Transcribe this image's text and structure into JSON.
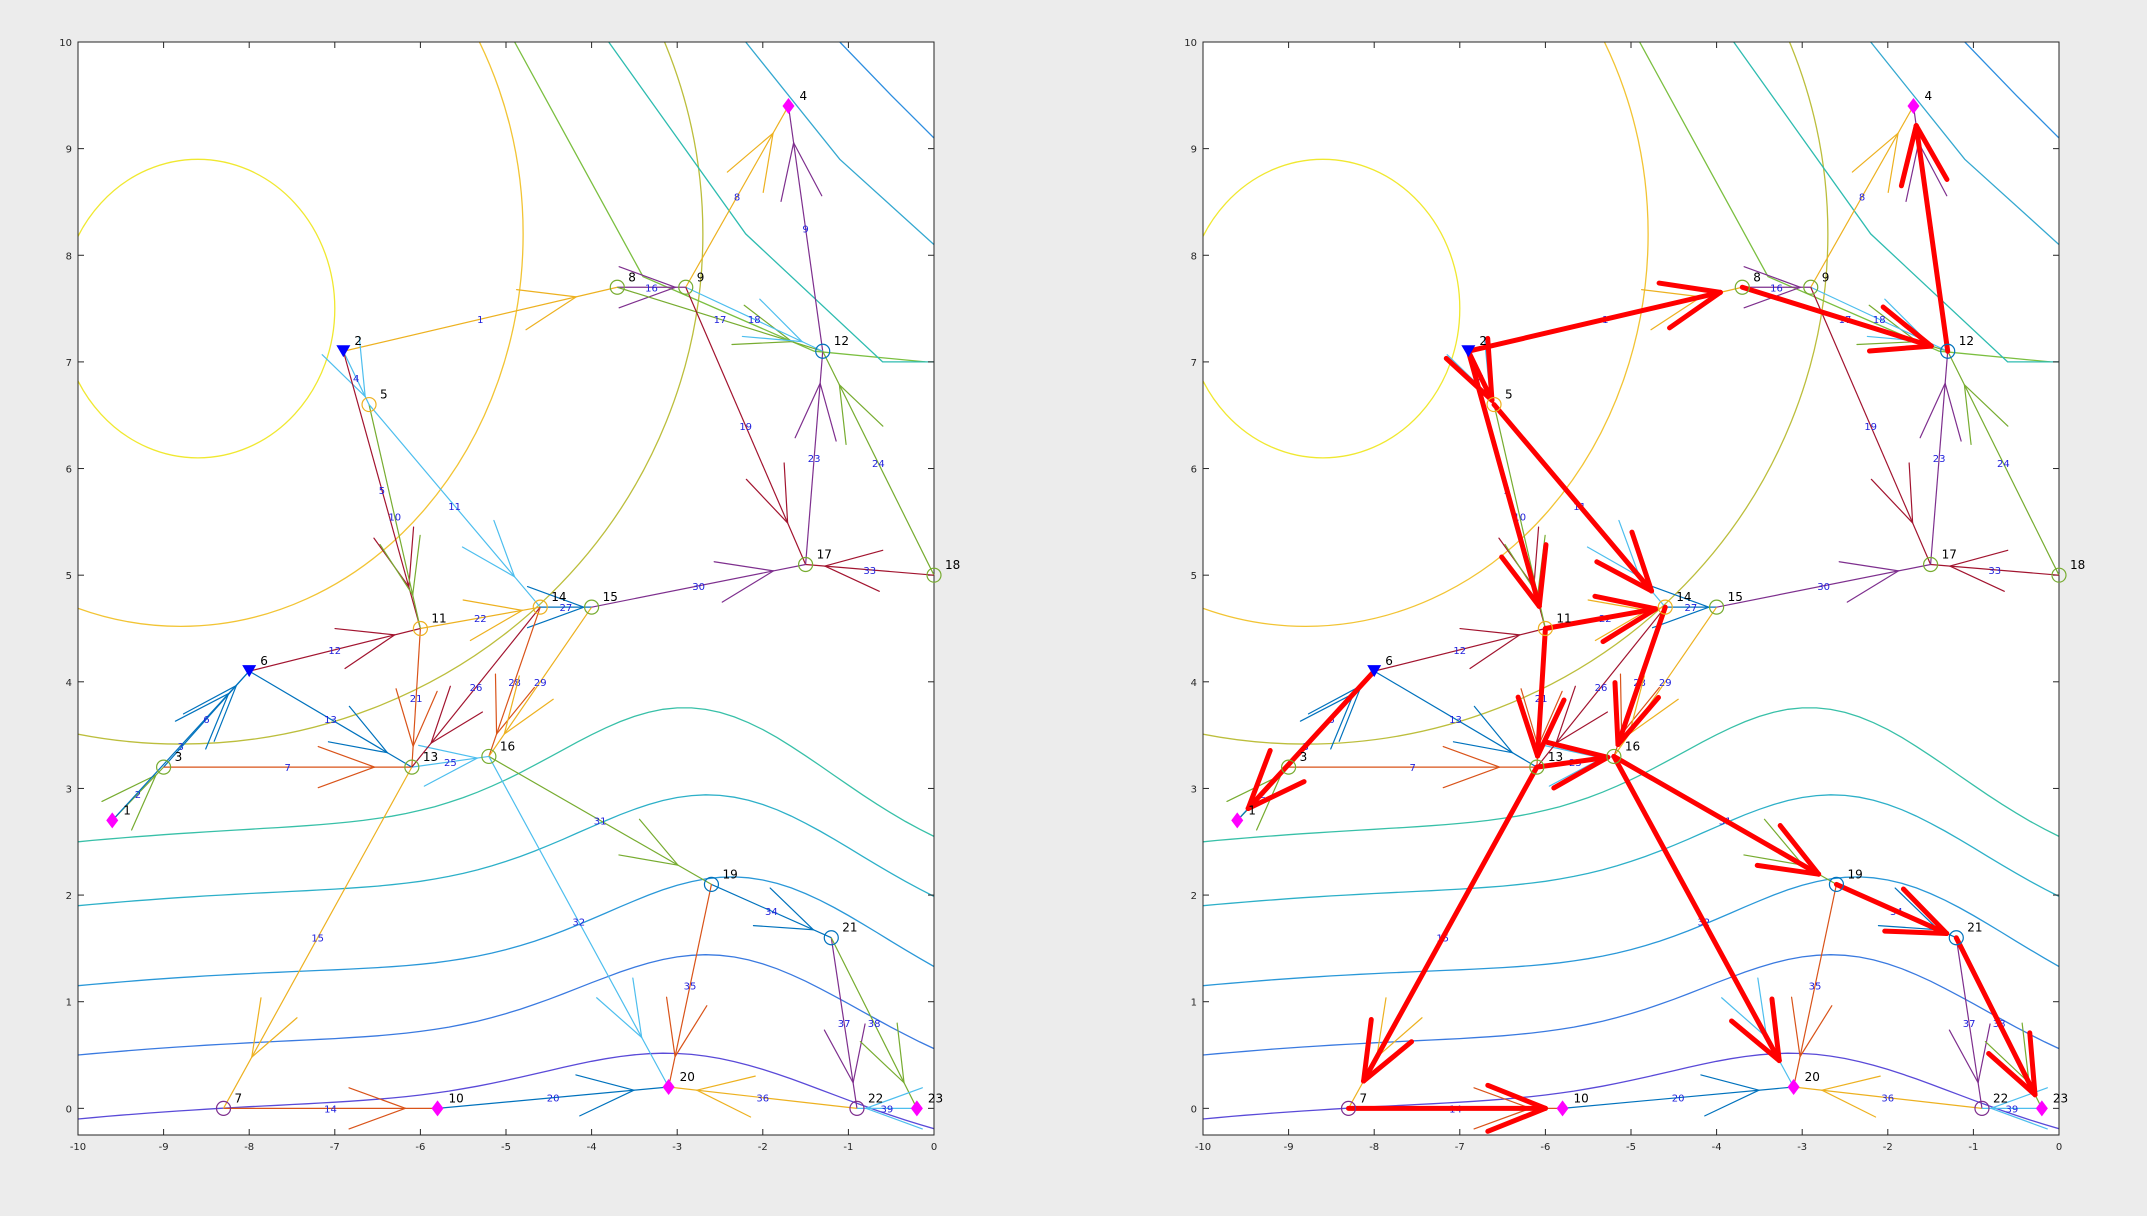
{
  "chart_data": [
    {
      "type": "network",
      "xlim": [
        -10,
        0
      ],
      "ylim": [
        -0.25,
        10
      ],
      "xticks": [
        -10,
        -9,
        -8,
        -7,
        -6,
        -5,
        -4,
        -3,
        -2,
        -1,
        0
      ],
      "yticks": [
        0,
        1,
        2,
        3,
        4,
        5,
        6,
        7,
        8,
        9,
        10
      ],
      "highlight_path": []
    },
    {
      "type": "network",
      "xlim": [
        -10,
        0
      ],
      "ylim": [
        -0.25,
        10
      ],
      "xticks": [
        -10,
        -9,
        -8,
        -7,
        -6,
        -5,
        -4,
        -3,
        -2,
        -1,
        0
      ],
      "yticks": [
        0,
        1,
        2,
        3,
        4,
        5,
        6,
        7,
        8,
        9,
        10
      ],
      "highlight_path": [
        2,
        5,
        11,
        13,
        16,
        19,
        21,
        23,
        8,
        12,
        4,
        6,
        1,
        7,
        10,
        14,
        15,
        20
      ],
      "highlight_color": "#ff0000"
    }
  ],
  "nodes": [
    {
      "id": 1,
      "label": "1",
      "x": -9.6,
      "y": 2.7,
      "marker": "diamond",
      "color": "#ff00ff"
    },
    {
      "id": 2,
      "label": "2",
      "x": -6.9,
      "y": 7.1,
      "marker": "triangle",
      "color": "#0000ff"
    },
    {
      "id": 3,
      "label": "3",
      "x": -9.0,
      "y": 3.2,
      "marker": "circle",
      "color": "#77ac30"
    },
    {
      "id": 4,
      "label": "4",
      "x": -1.7,
      "y": 9.4,
      "marker": "diamond",
      "color": "#ff00ff"
    },
    {
      "id": 5,
      "label": "5",
      "x": -6.6,
      "y": 6.6,
      "marker": "circle",
      "color": "#edb120"
    },
    {
      "id": 6,
      "label": "6",
      "x": -8.0,
      "y": 4.1,
      "marker": "triangle",
      "color": "#0000ff"
    },
    {
      "id": 7,
      "label": "7",
      "x": -8.3,
      "y": 0.0,
      "marker": "circle",
      "color": "#7e2f8e"
    },
    {
      "id": 8,
      "label": "8",
      "x": -3.7,
      "y": 7.7,
      "marker": "circle",
      "color": "#77ac30"
    },
    {
      "id": 9,
      "label": "9",
      "x": -2.9,
      "y": 7.7,
      "marker": "circle",
      "color": "#77ac30"
    },
    {
      "id": 10,
      "label": "10",
      "x": -5.8,
      "y": 0.0,
      "marker": "diamond",
      "color": "#ff00ff"
    },
    {
      "id": 11,
      "label": "11",
      "x": -6.0,
      "y": 4.5,
      "marker": "circle",
      "color": "#edb120"
    },
    {
      "id": 12,
      "label": "12",
      "x": -1.3,
      "y": 7.1,
      "marker": "circle",
      "color": "#0072bd"
    },
    {
      "id": 13,
      "label": "13",
      "x": -6.1,
      "y": 3.2,
      "marker": "circle",
      "color": "#77ac30"
    },
    {
      "id": 14,
      "label": "14",
      "x": -4.6,
      "y": 4.7,
      "marker": "circle",
      "color": "#edb120"
    },
    {
      "id": 15,
      "label": "15",
      "x": -4.0,
      "y": 4.7,
      "marker": "circle",
      "color": "#77ac30"
    },
    {
      "id": 16,
      "label": "16",
      "x": -5.2,
      "y": 3.3,
      "marker": "circle",
      "color": "#77ac30"
    },
    {
      "id": 17,
      "label": "17",
      "x": -1.5,
      "y": 5.1,
      "marker": "circle",
      "color": "#77ac30"
    },
    {
      "id": 18,
      "label": "18",
      "x": 0.0,
      "y": 5.0,
      "marker": "circle",
      "color": "#77ac30"
    },
    {
      "id": 19,
      "label": "19",
      "x": -2.6,
      "y": 2.1,
      "marker": "circle",
      "color": "#0072bd"
    },
    {
      "id": 20,
      "label": "20",
      "x": -3.1,
      "y": 0.2,
      "marker": "diamond",
      "color": "#ff00ff"
    },
    {
      "id": 21,
      "label": "21",
      "x": -1.2,
      "y": 1.6,
      "marker": "circle",
      "color": "#0072bd"
    },
    {
      "id": 22,
      "label": "22",
      "x": -0.9,
      "y": 0.0,
      "marker": "circle",
      "color": "#7e2f8e"
    },
    {
      "id": 23,
      "label": "23",
      "x": -0.2,
      "y": 0.0,
      "marker": "diamond",
      "color": "#ff00ff"
    }
  ],
  "edges": [
    {
      "id": 1,
      "label": "1",
      "from": 2,
      "to": 8,
      "color": "#edb120"
    },
    {
      "id": 2,
      "label": "2",
      "from": 1,
      "to": 3,
      "color": "#77ac30"
    },
    {
      "id": 3,
      "label": "3",
      "from": 1,
      "to": 6,
      "color": "#0072bd"
    },
    {
      "id": 4,
      "label": "4",
      "from": 2,
      "to": 5,
      "color": "#4dbeee"
    },
    {
      "id": 5,
      "label": "5",
      "from": 2,
      "to": 11,
      "color": "#a2142f"
    },
    {
      "id": 6,
      "label": "6",
      "from": 3,
      "to": 6,
      "color": "#0072bd"
    },
    {
      "id": 7,
      "label": "7",
      "from": 3,
      "to": 13,
      "color": "#d95319"
    },
    {
      "id": 8,
      "label": "8",
      "from": 9,
      "to": 4,
      "color": "#edb120"
    },
    {
      "id": 9,
      "label": "9",
      "from": 12,
      "to": 4,
      "color": "#7e2f8e"
    },
    {
      "id": 10,
      "label": "10",
      "from": 5,
      "to": 11,
      "color": "#77ac30"
    },
    {
      "id": 11,
      "label": "11",
      "from": 5,
      "to": 14,
      "color": "#4dbeee"
    },
    {
      "id": 12,
      "label": "12",
      "from": 6,
      "to": 11,
      "color": "#a2142f"
    },
    {
      "id": 13,
      "label": "13",
      "from": 6,
      "to": 13,
      "color": "#0072bd"
    },
    {
      "id": 14,
      "label": "14",
      "from": 7,
      "to": 10,
      "color": "#d95319"
    },
    {
      "id": 15,
      "label": "15",
      "from": 13,
      "to": 7,
      "color": "#edb120"
    },
    {
      "id": 16,
      "label": "16",
      "from": 8,
      "to": 9,
      "color": "#7e2f8e"
    },
    {
      "id": 17,
      "label": "17",
      "from": 8,
      "to": 12,
      "color": "#77ac30"
    },
    {
      "id": 18,
      "label": "18",
      "from": 9,
      "to": 12,
      "color": "#4dbeee"
    },
    {
      "id": 19,
      "label": "19",
      "from": 9,
      "to": 17,
      "color": "#a2142f"
    },
    {
      "id": 20,
      "label": "20",
      "from": 10,
      "to": 20,
      "color": "#0072bd"
    },
    {
      "id": 21,
      "label": "21",
      "from": 11,
      "to": 13,
      "color": "#d95319"
    },
    {
      "id": 22,
      "label": "22",
      "from": 11,
      "to": 14,
      "color": "#edb120"
    },
    {
      "id": 23,
      "label": "23",
      "from": 17,
      "to": 12,
      "color": "#7e2f8e"
    },
    {
      "id": 24,
      "label": "24",
      "from": 18,
      "to": 12,
      "color": "#77ac30"
    },
    {
      "id": 25,
      "label": "25",
      "from": 13,
      "to": 16,
      "color": "#4dbeee"
    },
    {
      "id": 26,
      "label": "26",
      "from": 14,
      "to": 13,
      "color": "#a2142f"
    },
    {
      "id": 27,
      "label": "27",
      "from": 14,
      "to": 15,
      "color": "#0072bd"
    },
    {
      "id": 28,
      "label": "28",
      "from": 14,
      "to": 16,
      "color": "#d95319"
    },
    {
      "id": 29,
      "label": "29",
      "from": 15,
      "to": 16,
      "color": "#edb120"
    },
    {
      "id": 30,
      "label": "30",
      "from": 15,
      "to": 17,
      "color": "#7e2f8e"
    },
    {
      "id": 31,
      "label": "31",
      "from": 16,
      "to": 19,
      "color": "#77ac30"
    },
    {
      "id": 32,
      "label": "32",
      "from": 16,
      "to": 20,
      "color": "#4dbeee"
    },
    {
      "id": 33,
      "label": "33",
      "from": 18,
      "to": 17,
      "color": "#a2142f"
    },
    {
      "id": 34,
      "label": "34",
      "from": 19,
      "to": 21,
      "color": "#0072bd"
    },
    {
      "id": 35,
      "label": "35",
      "from": 19,
      "to": 20,
      "color": "#d95319"
    },
    {
      "id": 36,
      "label": "36",
      "from": 22,
      "to": 20,
      "color": "#edb120"
    },
    {
      "id": 37,
      "label": "37",
      "from": 21,
      "to": 22,
      "color": "#7e2f8e"
    },
    {
      "id": 38,
      "label": "38",
      "from": 21,
      "to": 23,
      "color": "#77ac30"
    },
    {
      "id": 39,
      "label": "39",
      "from": 23,
      "to": 22,
      "color": "#4dbeee"
    }
  ],
  "highlight_edges": [
    {
      "from": 2,
      "to": 8
    },
    {
      "from": 2,
      "to": 5
    },
    {
      "from": 2,
      "to": 11
    },
    {
      "from": 5,
      "to": 14
    },
    {
      "from": 11,
      "to": 14
    },
    {
      "from": 11,
      "to": 13
    },
    {
      "from": 14,
      "to": 16
    },
    {
      "from": 13,
      "to": 16
    },
    {
      "from": 13,
      "to": 7
    },
    {
      "from": 7,
      "to": 10
    },
    {
      "from": 16,
      "to": 19
    },
    {
      "from": 16,
      "to": 20
    },
    {
      "from": 19,
      "to": 21
    },
    {
      "from": 21,
      "to": 23
    },
    {
      "from": 8,
      "to": 12
    },
    {
      "from": 12,
      "to": 4
    },
    {
      "from": 6,
      "to": 1
    }
  ]
}
